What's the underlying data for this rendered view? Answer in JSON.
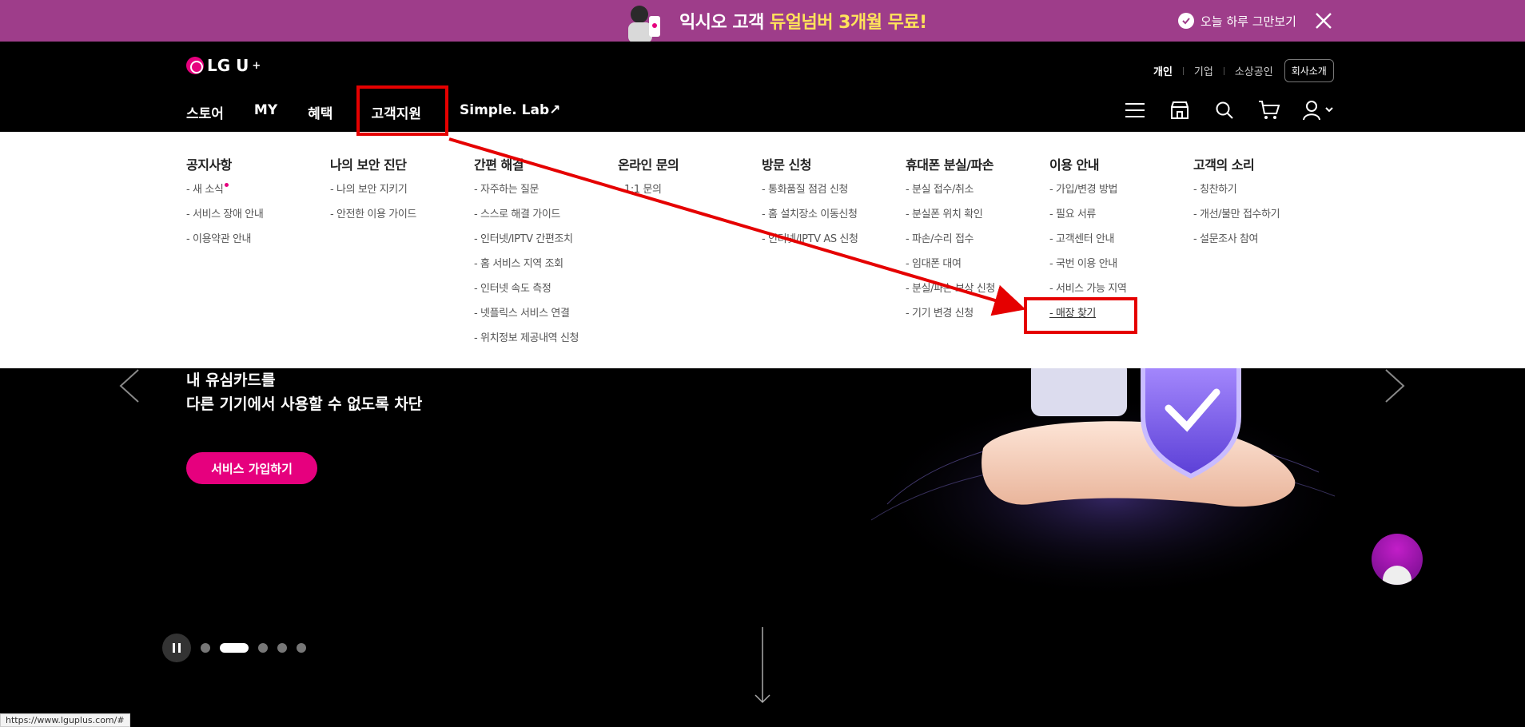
{
  "promo": {
    "text_prefix": "익시오 고객 ",
    "text_highlight": "듀얼넘버 3개월 무료!",
    "today_label": "오늘 하루 그만보기"
  },
  "header": {
    "logo_text": "LG U",
    "logo_sup": "+",
    "util_links": [
      "개인",
      "기업",
      "소상공인"
    ],
    "company_button": "회사소개",
    "nav": [
      "스토어",
      "MY",
      "혜택",
      "고객지원",
      "Simple. Lab↗"
    ],
    "icons": [
      "menu-icon",
      "store-icon",
      "search-icon",
      "cart-icon",
      "user-icon"
    ]
  },
  "mega_menu": {
    "columns": [
      {
        "title": "공지사항",
        "items": [
          "- 새 소식",
          "- 서비스 장애 안내",
          "- 이용약관 안내"
        ]
      },
      {
        "title": "나의 보안 진단",
        "items": [
          "- 나의 보안 지키기",
          "- 안전한 이용 가이드"
        ]
      },
      {
        "title": "간편 해결",
        "items": [
          "- 자주하는 질문",
          "- 스스로 해결 가이드",
          "- 인터넷/IPTV 간편조치",
          "- 홈 서비스 지역 조회",
          "- 인터넷 속도 측정",
          "- 넷플릭스 서비스 연결",
          "- 위치정보 제공내역 신청"
        ]
      },
      {
        "title": "온라인 문의",
        "items": [
          "- 1:1 문의"
        ]
      },
      {
        "title": "방문 신청",
        "items": [
          "- 통화품질 점검 신청",
          "- 홈 설치장소 이동신청",
          "- 인터넷/IPTV AS 신청"
        ]
      },
      {
        "title": "휴대폰 분실/파손",
        "items": [
          "- 분실 접수/취소",
          "- 분실폰 위치 확인",
          "- 파손/수리 접수",
          "- 임대폰 대여",
          "- 분실/파손 보상 신청",
          "- 기기 변경 신청"
        ]
      },
      {
        "title": "이용 안내",
        "items": [
          "- 가입/변경 방법",
          "- 필요 서류",
          "- 고객센터 안내",
          "- 국번 이용 안내",
          "- 서비스 가능 지역",
          "- 매장 찾기"
        ]
      },
      {
        "title": "고객의 소리",
        "items": [
          "- 칭찬하기",
          "- 개선/불만 접수하기",
          "- 설문조사 참여"
        ]
      }
    ]
  },
  "hero": {
    "line1": "내 유심카드를",
    "line2": "다른 기기에서 사용할 수 없도록 차단",
    "cta": "서비스 가입하기"
  },
  "status_url": "https://www.lguplus.com/#",
  "colors": {
    "promo_bg": "#9e3d8a",
    "accent": "#e6007e",
    "annotation": "#e50000"
  }
}
